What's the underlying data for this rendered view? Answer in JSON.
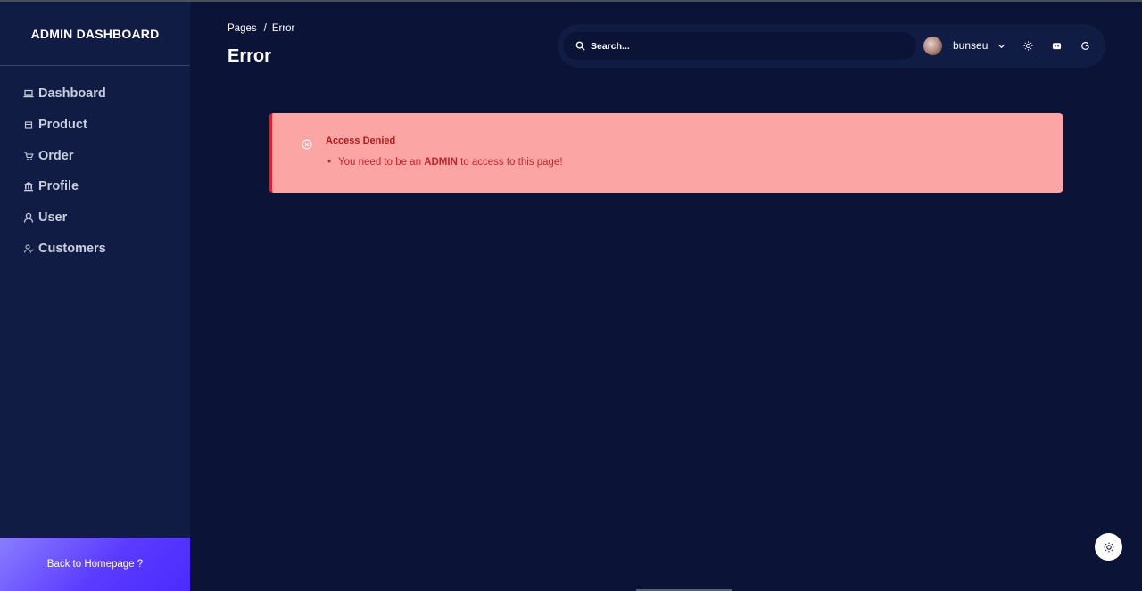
{
  "sidebar": {
    "brand": "ADMIN DASHBOARD",
    "items": [
      {
        "label": "Dashboard",
        "icon": "laptop-icon"
      },
      {
        "label": "Product",
        "icon": "box-icon"
      },
      {
        "label": "Order",
        "icon": "cart-icon"
      },
      {
        "label": "Profile",
        "icon": "bank-icon"
      },
      {
        "label": "User",
        "icon": "user-icon"
      },
      {
        "label": "Customers",
        "icon": "customers-icon"
      }
    ],
    "back_label": "Back to Homepage ?"
  },
  "header": {
    "breadcrumb": {
      "root": "Pages",
      "separator": "/",
      "current": "Error"
    },
    "title": "Error"
  },
  "topbar": {
    "search_placeholder": "Search...",
    "username": "bunseu"
  },
  "alert": {
    "title": "Access Denied",
    "message_before": "You need to be an",
    "message_bold": "ADMIN",
    "message_after": "to access to this page!"
  },
  "colors": {
    "background": "#0b1437",
    "sidebar": "#111c44",
    "alert_bg": "#fca5a5",
    "alert_border": "#e11d2a",
    "alert_text": "#b21a1a",
    "accent": "#5b3bff"
  }
}
